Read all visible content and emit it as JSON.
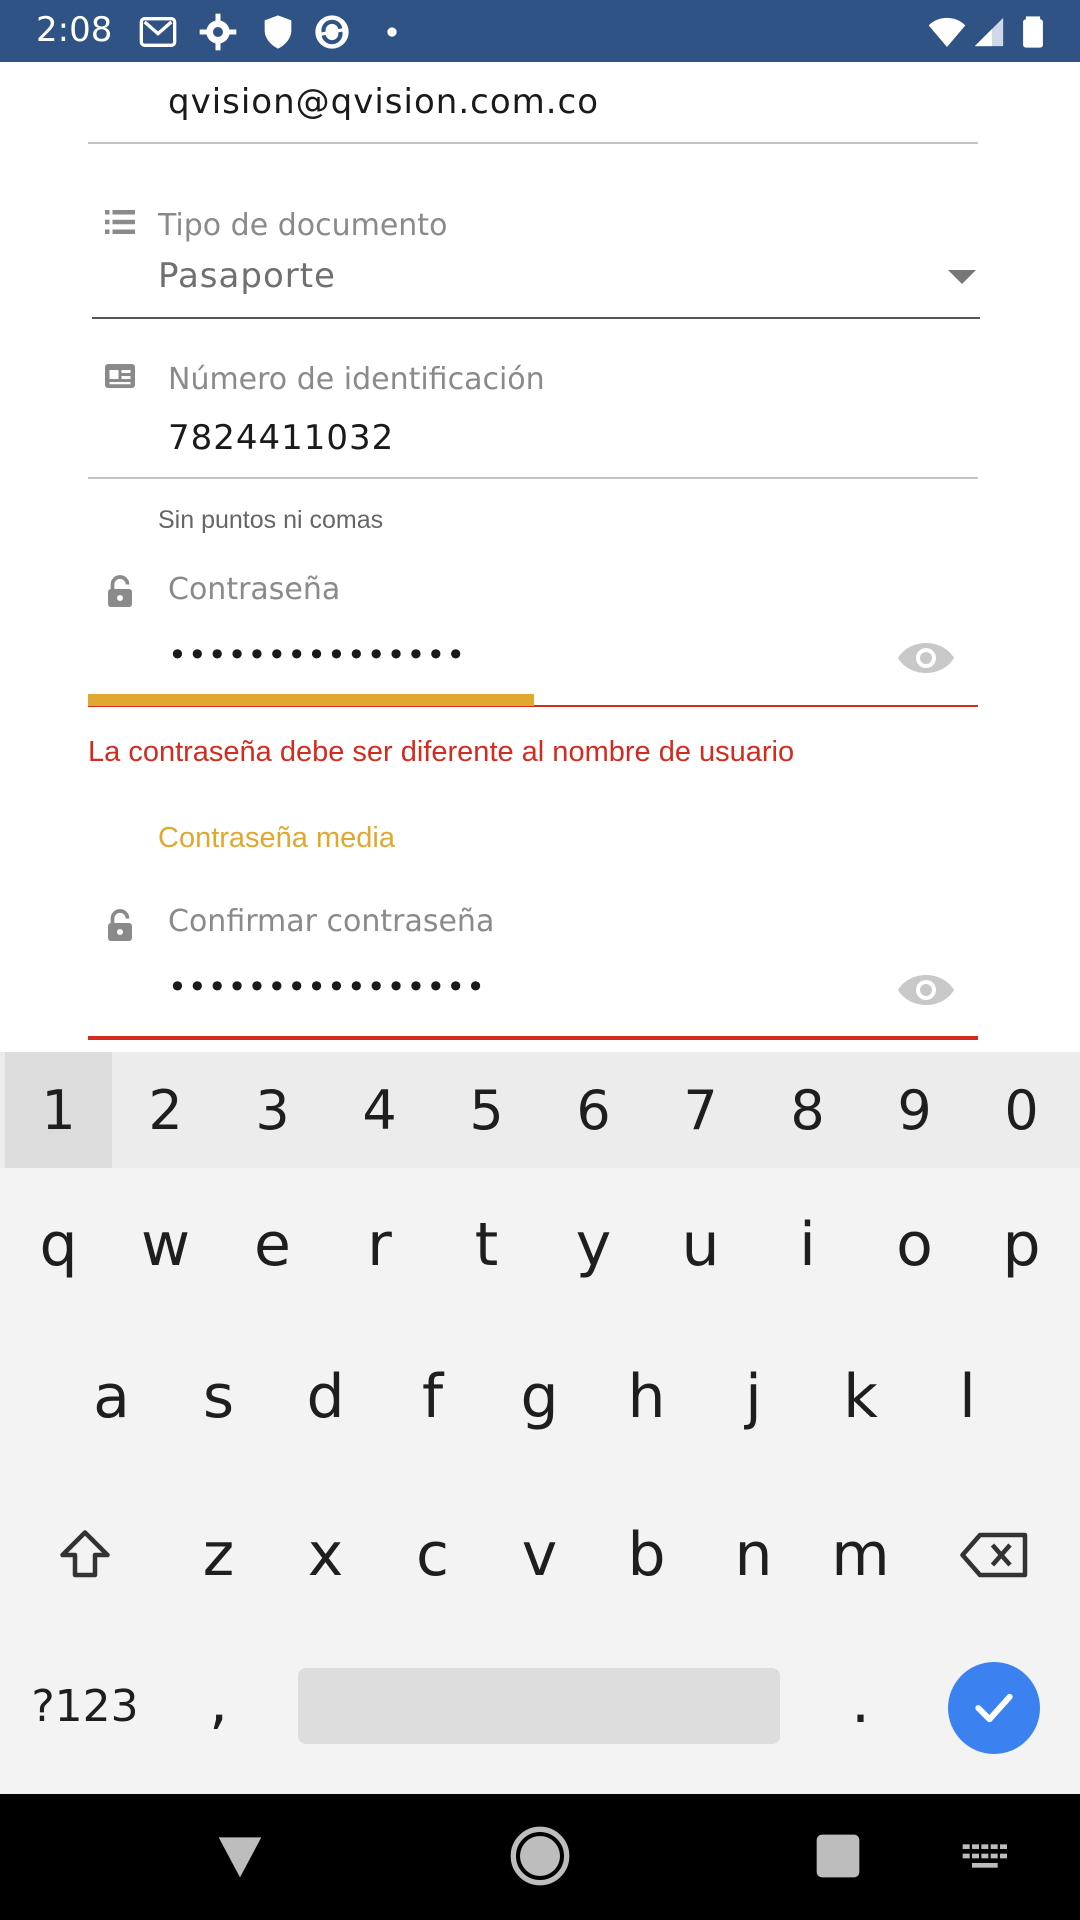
{
  "status_bar": {
    "time": "2:08",
    "icons": [
      "gmail-icon",
      "settings-icon",
      "shield-icon",
      "sync-app-icon",
      "dot-icon",
      "wifi-icon",
      "signal-icon",
      "battery-icon"
    ]
  },
  "form": {
    "email": {
      "value": "qvision@qvision.com.co"
    },
    "document_type": {
      "label": "Tipo de documento",
      "value": "Pasaporte",
      "icon": "list-icon"
    },
    "id_number": {
      "label": "Número de identificación",
      "value": "7824411032",
      "helper": "Sin puntos ni comas",
      "icon": "id-card-icon"
    },
    "password": {
      "label": "Contraseña",
      "value": "•••••••••••••••",
      "error": "La contraseña debe ser diferente al nombre de usuario",
      "strength_text": "Contraseña media",
      "strength_fraction": 0.5,
      "icon": "lock-icon"
    },
    "confirm_password": {
      "label": "Confirmar contraseña",
      "value": "••••••••••••••••",
      "icon": "lock-icon"
    },
    "colors": {
      "error": "#d52b1e",
      "strength": "#e0a82e"
    }
  },
  "keyboard": {
    "numbers": [
      "1",
      "2",
      "3",
      "4",
      "5",
      "6",
      "7",
      "8",
      "9",
      "0"
    ],
    "row1": [
      "q",
      "w",
      "e",
      "r",
      "t",
      "y",
      "u",
      "i",
      "o",
      "p"
    ],
    "row2": [
      "a",
      "s",
      "d",
      "f",
      "g",
      "h",
      "j",
      "k",
      "l"
    ],
    "row3": [
      "z",
      "x",
      "c",
      "v",
      "b",
      "n",
      "m"
    ],
    "symbols_key": "?123",
    "comma": ",",
    "period": ".",
    "enter_color": "#3b82f0"
  },
  "nav_bar": {
    "buttons": [
      "back-icon",
      "home-icon",
      "recents-icon",
      "keyboard-switch-icon"
    ]
  }
}
